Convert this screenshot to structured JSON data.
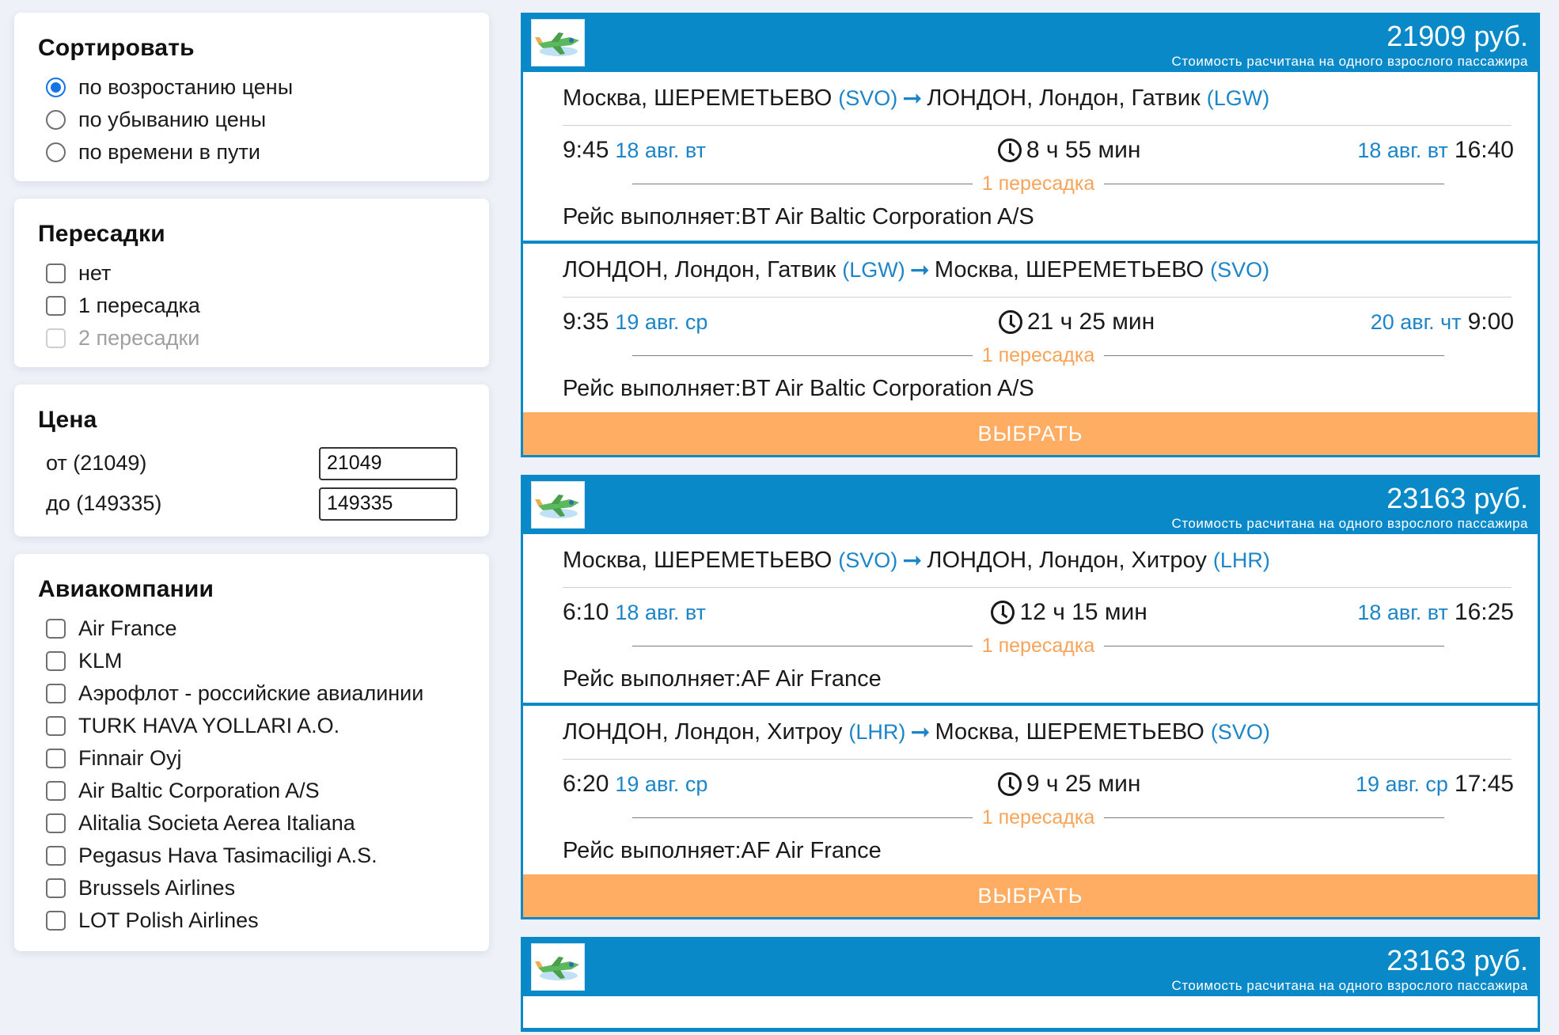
{
  "filters": {
    "sort": {
      "title": "Сортировать",
      "options": [
        "по возростанию цены",
        "по убыванию цены",
        "по времени в пути"
      ],
      "selected_index": 0
    },
    "transfers": {
      "title": "Пересадки",
      "options": [
        "нет",
        "1 пересадка",
        "2 пересадки"
      ]
    },
    "price": {
      "title": "Цена",
      "from_label": "от (21049)",
      "from_value": "21049",
      "to_label": "до (149335)",
      "to_value": "149335"
    },
    "airlines": {
      "title": "Авиакомпании",
      "options": [
        "Air France",
        "KLM",
        "Аэрофлот - российские авиалинии",
        "TURK HAVA YOLLARI A.O.",
        "Finnair Oyj",
        "Air Baltic Corporation A/S",
        "Alitalia Societa Aerea Italiana",
        "Pegasus Hava Tasimaciligi A.S.",
        "Brussels Airlines",
        "LOT Polish Airlines"
      ]
    }
  },
  "tickets": [
    {
      "price": "21909 руб.",
      "price_note": "Стоимость расчитана на одного взрослого пассажира",
      "select_label": "ВЫБРАТЬ",
      "legs": [
        {
          "from": "Москва, ШЕРЕМЕТЬЕВО",
          "from_code": "(SVO)",
          "to": "ЛОНДОН, Лондон, Гатвик",
          "to_code": "(LGW)",
          "dep_time": "9:45",
          "dep_date": "18 авг. вт",
          "duration": "8 ч 55 мин",
          "arr_date": "18 авг. вт",
          "arr_time": "16:40",
          "transfers": "1 пересадка",
          "carrier": "Рейс выполняет:BT Air Baltic Corporation A/S"
        },
        {
          "from": "ЛОНДОН, Лондон, Гатвик",
          "from_code": "(LGW)",
          "to": "Москва, ШЕРЕМЕТЬЕВО",
          "to_code": "(SVO)",
          "dep_time": "9:35",
          "dep_date": "19 авг. ср",
          "duration": "21 ч 25 мин",
          "arr_date": "20 авг. чт",
          "arr_time": "9:00",
          "transfers": "1 пересадка",
          "carrier": "Рейс выполняет:BT Air Baltic Corporation A/S"
        }
      ]
    },
    {
      "price": "23163 руб.",
      "price_note": "Стоимость расчитана на одного взрослого пассажира",
      "select_label": "ВЫБРАТЬ",
      "legs": [
        {
          "from": "Москва, ШЕРЕМЕТЬЕВО",
          "from_code": "(SVO)",
          "to": "ЛОНДОН, Лондон, Хитроу",
          "to_code": "(LHR)",
          "dep_time": "6:10",
          "dep_date": "18 авг. вт",
          "duration": "12 ч 15 мин",
          "arr_date": "18 авг. вт",
          "arr_time": "16:25",
          "transfers": "1 пересадка",
          "carrier": "Рейс выполняет:AF Air France"
        },
        {
          "from": "ЛОНДОН, Лондон, Хитроу",
          "from_code": "(LHR)",
          "to": "Москва, ШЕРЕМЕТЬЕВО",
          "to_code": "(SVO)",
          "dep_time": "6:20",
          "dep_date": "19 авг. ср",
          "duration": "9 ч 25 мин",
          "arr_date": "19 авг. ср",
          "arr_time": "17:45",
          "transfers": "1 пересадка",
          "carrier": "Рейс выполняет:AF Air France"
        }
      ]
    },
    {
      "price": "23163 руб.",
      "price_note": "Стоимость расчитана на одного взрослого пассажира"
    }
  ],
  "icons": {
    "logo": "airplane-logo-icon",
    "arrow": "arrow-right-icon",
    "clock": "clock-icon"
  },
  "colors": {
    "accent_blue": "#0a89c8",
    "link_blue": "#1c85c9",
    "select_orange": "#ffad62",
    "transfer_orange": "#f7a45a",
    "radio_blue": "#1473e6"
  }
}
